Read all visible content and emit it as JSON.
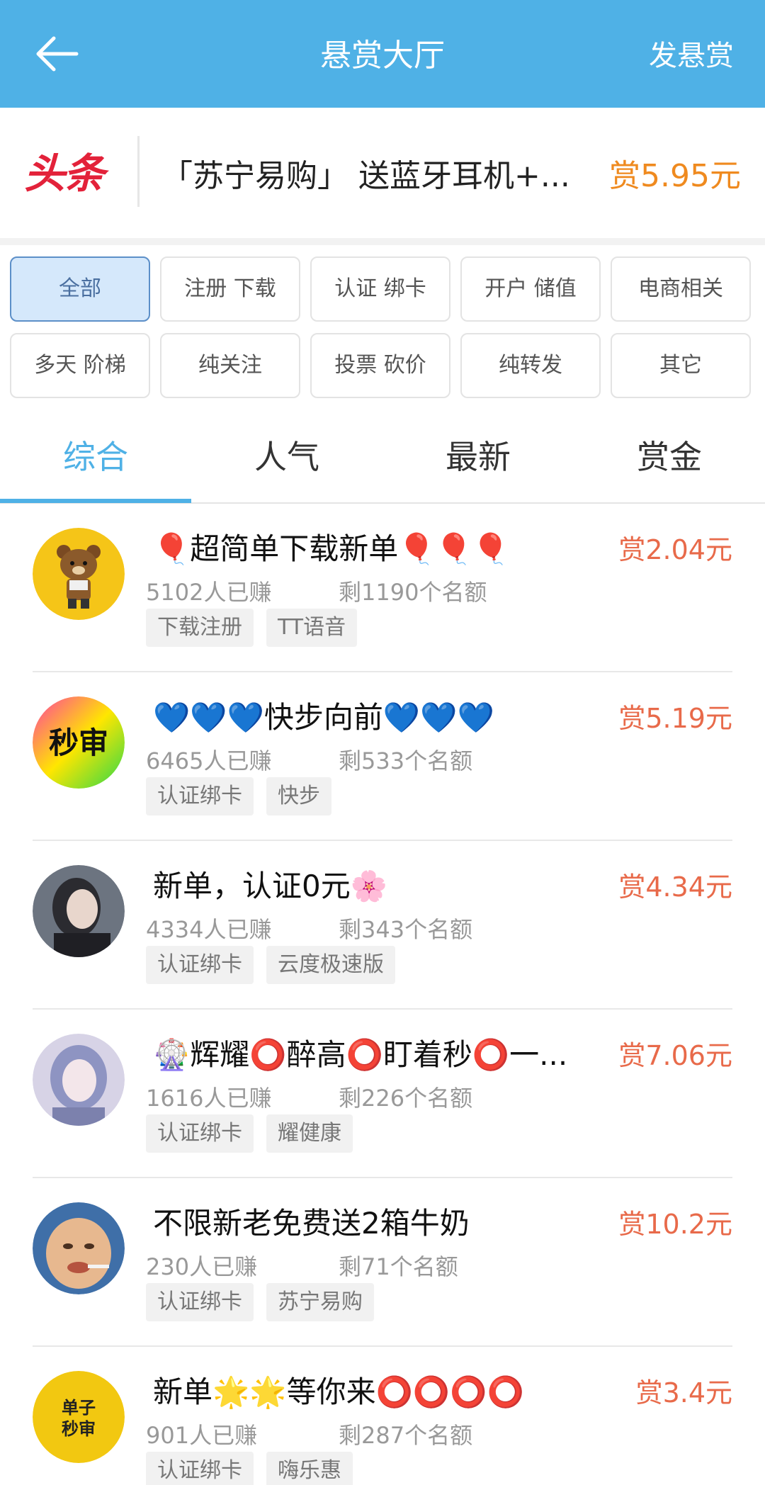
{
  "header": {
    "title": "悬赏大厅",
    "post_label": "发悬赏"
  },
  "headline": {
    "logo": "头条",
    "text": "「苏宁易购」 送蓝牙耳机+...",
    "reward": "赏5.95元"
  },
  "categories": [
    "全部",
    "注册 下载",
    "认证 绑卡",
    "开户 储值",
    "电商相关",
    "多天 阶梯",
    "纯关注",
    "投票 砍价",
    "纯转发",
    "其它"
  ],
  "tabs": [
    "综合",
    "人气",
    "最新",
    "赏金"
  ],
  "tasks": [
    {
      "title": "🎈超简单下载新单🎈🎈🎈",
      "reward": "赏2.04元",
      "earned": "5102人已赚",
      "remaining": "剩1190个名额",
      "tags": [
        "下载注册",
        "TT语音"
      ],
      "avatar": "bear"
    },
    {
      "title": "💙💙💙快步向前💙💙💙",
      "reward": "赏5.19元",
      "earned": "6465人已赚",
      "remaining": "剩533个名额",
      "tags": [
        "认证绑卡",
        "快步"
      ],
      "avatar": "秒审"
    },
    {
      "title": "新单，认证0元🌸",
      "reward": "赏4.34元",
      "earned": "4334人已赚",
      "remaining": "剩343个名额",
      "tags": [
        "认证绑卡",
        "云度极速版"
      ],
      "avatar": "girl1"
    },
    {
      "title": "🎡辉耀⭕醉高⭕盯着秒⭕一...",
      "reward": "赏7.06元",
      "earned": "1616人已赚",
      "remaining": "剩226个名额",
      "tags": [
        "认证绑卡",
        "耀健康"
      ],
      "avatar": "girl2"
    },
    {
      "title": "不限新老免费送2箱牛奶",
      "reward": "赏10.2元",
      "earned": "230人已赚",
      "remaining": "剩71个名额",
      "tags": [
        "认证绑卡",
        "苏宁易购"
      ],
      "avatar": "baby"
    },
    {
      "title": "新单🌟🌟等你来⭕⭕⭕⭕",
      "reward": "赏3.4元",
      "earned": "901人已赚",
      "remaining": "剩287个名额",
      "tags": [
        "认证绑卡",
        "嗨乐惠"
      ],
      "avatar": "单子秒审"
    }
  ]
}
